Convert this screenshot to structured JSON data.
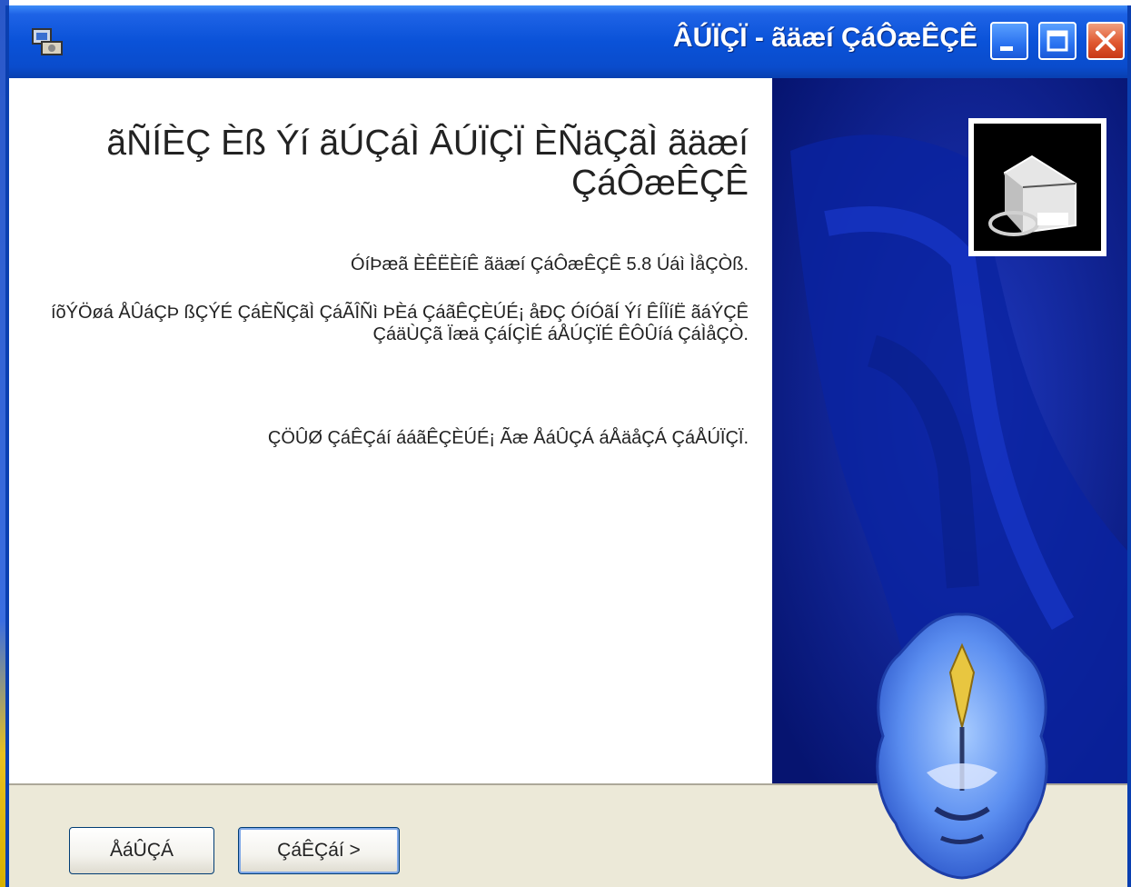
{
  "window": {
    "title": "ÂÚÏÇÏ - ãäæí ÇáÔæÊÇÊ",
    "controls": {
      "minimize": "minimize",
      "maximize": "maximize",
      "close": "close"
    }
  },
  "welcome": {
    "heading": "ãÑÍÈÇ Èß Ýí ãÚÇáÌ ÂÚÏÇÏ ÈÑäÇãÌ ãäæí ÇáÔæÊÇÊ",
    "paragraphs": [
      "ÓíÞæã ÈÊËÈíÊ ãäæí ÇáÔæÊÇÊ 5.8 Úáì ÌåÇÒß.",
      "íõÝÖøá ÅÛáÇÞ ßÇÝÉ ÇáÈÑÇãÌ ÇáÃÎÑì ÞÈá ÇáãÊÇÈÚÉ¡ åÐÇ ÓíÓãÍ Ýí ÊÍÏíË ãáÝÇÊ ÇáäÙÇã Ïæä ÇáÍÇÌÉ áÅÚÇÏÉ ÊÔÛíá ÇáÌåÇÒ.",
      "ÇÖÛØ ÇáÊÇáí ááãÊÇÈÚÉ¡ Ãæ ÅáÛÇÁ áÅäåÇÁ ÇáÅÚÏÇÏ."
    ]
  },
  "buttons": {
    "cancel": "ÅáÛÇÁ",
    "next": "ÇáÊÇáí >"
  },
  "colors": {
    "titlebar": "#0a52d8",
    "side_panel": "#071a78",
    "dialog_face": "#ece9d8"
  }
}
